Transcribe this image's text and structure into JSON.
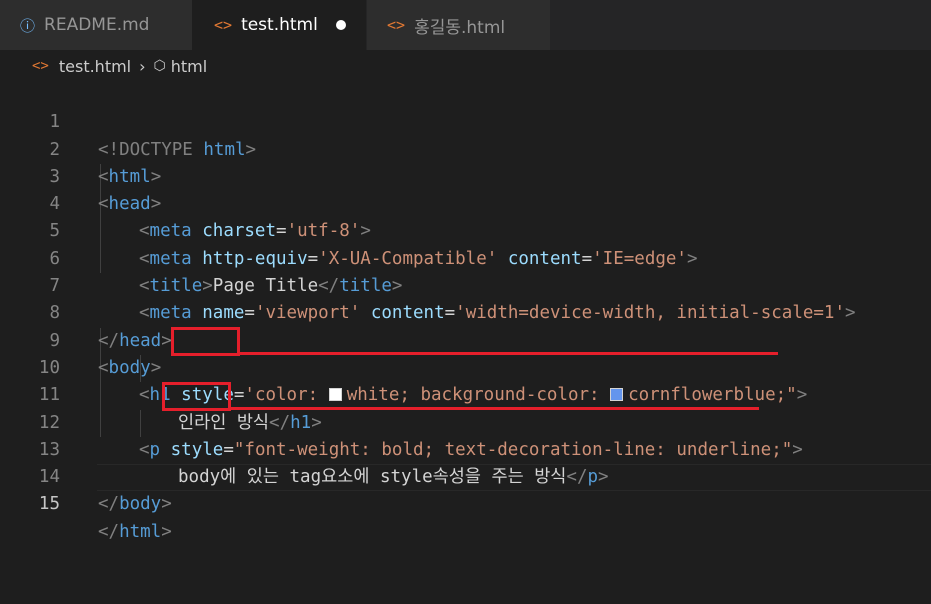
{
  "tabs": [
    {
      "label": "README.md",
      "icon": "info-icon",
      "active": false
    },
    {
      "label": "test.html",
      "icon": "html-code-icon",
      "active": true,
      "modified": true
    },
    {
      "label": "홍길동.html",
      "icon": "html-code-icon",
      "active": false
    }
  ],
  "breadcrumb": {
    "file": "test.html",
    "symbol": "html"
  },
  "editor": {
    "current_line": 15,
    "line_numbers": [
      "1",
      "2",
      "3",
      "4",
      "5",
      "6",
      "7",
      "8",
      "9",
      "10",
      "11",
      "12",
      "13",
      "14",
      "15"
    ],
    "tokens": {
      "doctype": "<!DOCTYPE",
      "html_word": "html",
      "gt": ">",
      "lt": "<",
      "lt_slash": "</",
      "html": "html",
      "head": "head",
      "meta": "meta",
      "charset": "charset",
      "eq": "=",
      "utf8": "'utf-8'",
      "http_equiv": "http-equiv",
      "x_ua": "'X-UA-Compatible'",
      "content": "content",
      "ie_edge": "'IE=edge'",
      "title": "title",
      "page_title": "Page Title",
      "name": "name",
      "viewport": "'viewport'",
      "viewport_content": "'width=device-width, initial-scale=1'",
      "body": "body",
      "h1": "h1",
      "style": "style",
      "h1_style_1": "'color: ",
      "h1_style_2": "white; background-color: ",
      "h1_style_3": "cornflowerblue;",
      "quote": "\"",
      "h1_text": "인라인 방식",
      "p": "p",
      "p_style": "\"font-weight: bold; text-decoration-line: underline;\"",
      "p_text": "body에 있는 tag요소에 style속성을 주는 방식"
    },
    "swatches": {
      "white": "#ffffff",
      "cornflowerblue": "#6495ed"
    }
  },
  "colors": {
    "annotation": "#e51f2b",
    "tag": "#569cd6",
    "attribute": "#9cdcfe",
    "string": "#ce9178"
  }
}
